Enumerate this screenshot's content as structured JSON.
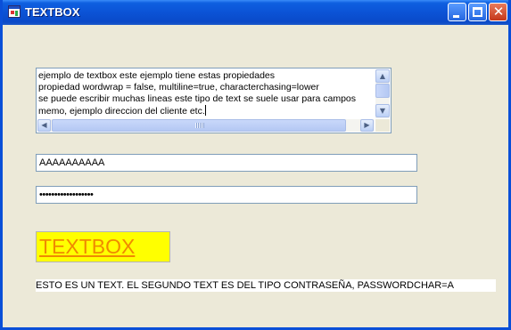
{
  "window": {
    "title": "TEXTBOX",
    "controls": {
      "minimize": "minimize-icon",
      "maximize": "maximize-icon",
      "close": "close-icon"
    }
  },
  "memo": {
    "lines": [
      "ejemplo de textbox este ejemplo tiene estas propiedades",
      "propiedad wordwrap = false, multiline=true, characterchasing=lower",
      "se puede escribir muchas lineas este tipo de text se suele usar para campos",
      "memo, ejemplo direccion del cliente etc."
    ]
  },
  "text_field": {
    "value": "AAAAAAAAAA"
  },
  "password_field": {
    "value": "••••••••••••••••••"
  },
  "title_label": {
    "text": "TEXTBOX",
    "background": "#ffff00",
    "color": "#f08a00"
  },
  "info_label": {
    "text": "ESTO ES UN TEXT. EL SEGUNDO TEXT ES DEL TIPO CONTRASEÑA, PASSWORDCHAR=A"
  },
  "colors": {
    "window_bg": "#ece9d8",
    "titlebar": "#0b53d6",
    "field_border": "#7f9db9"
  }
}
